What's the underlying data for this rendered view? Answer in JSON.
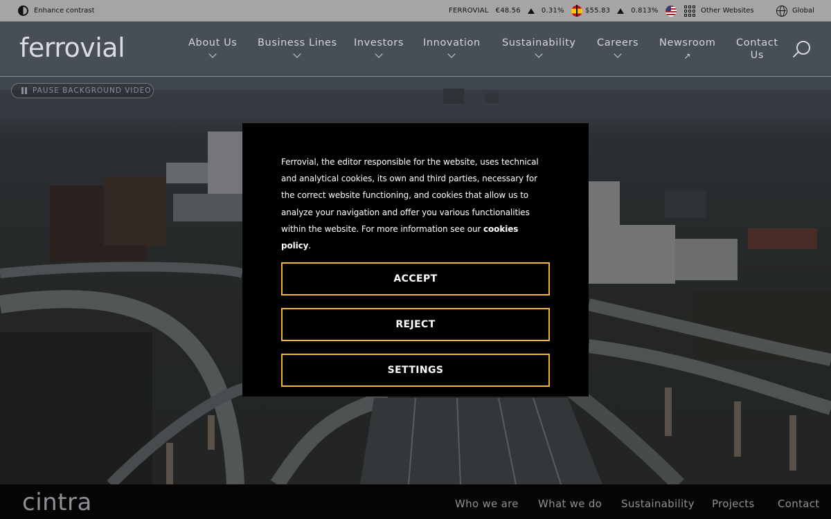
{
  "utility_bar": {
    "contrast_label": "Enhance contrast",
    "ticker_es": {
      "name": "FERROVIAL",
      "price": "€48.56",
      "change": "0.31%"
    },
    "ticker_us": {
      "price": "$55.83",
      "change": "0.813%"
    },
    "other_websites_label": "Other Websites",
    "global_label": "Global"
  },
  "header": {
    "logo_text": "ferrovial",
    "nav": [
      {
        "label": "About Us",
        "marker": "chevron"
      },
      {
        "label": "Business Lines",
        "marker": "chevron"
      },
      {
        "label": "Investors",
        "marker": "chevron"
      },
      {
        "label": "Innovation",
        "marker": "chevron"
      },
      {
        "label": "Sustainability",
        "marker": "chevron"
      },
      {
        "label": "Careers",
        "marker": "chevron"
      },
      {
        "label": "Newsroom",
        "marker": "external"
      },
      {
        "label_line1": "Contact",
        "label_line2": "Us",
        "marker": "none"
      }
    ]
  },
  "video_control": {
    "pause_label": "PAUSE BACKGROUND VIDEO"
  },
  "cookie_modal": {
    "text": "Ferrovial, the editor responsible for the website, uses technical and analytical cookies, its own and third parties, necessary for the correct website functioning, and cookies that allow us to analyze your navigation and offer you various functionalities within the website. For more information see our ",
    "policy_link": "cookies policy",
    "text_end": ".",
    "accept_label": "ACCEPT",
    "reject_label": "REJECT",
    "settings_label": "SETTINGS",
    "button_border_color": "#f2b632"
  },
  "footer_bar": {
    "logo_text": "cintra",
    "nav": [
      "Who we are",
      "What we do",
      "Sustainability",
      "Projects",
      "Contact"
    ]
  }
}
